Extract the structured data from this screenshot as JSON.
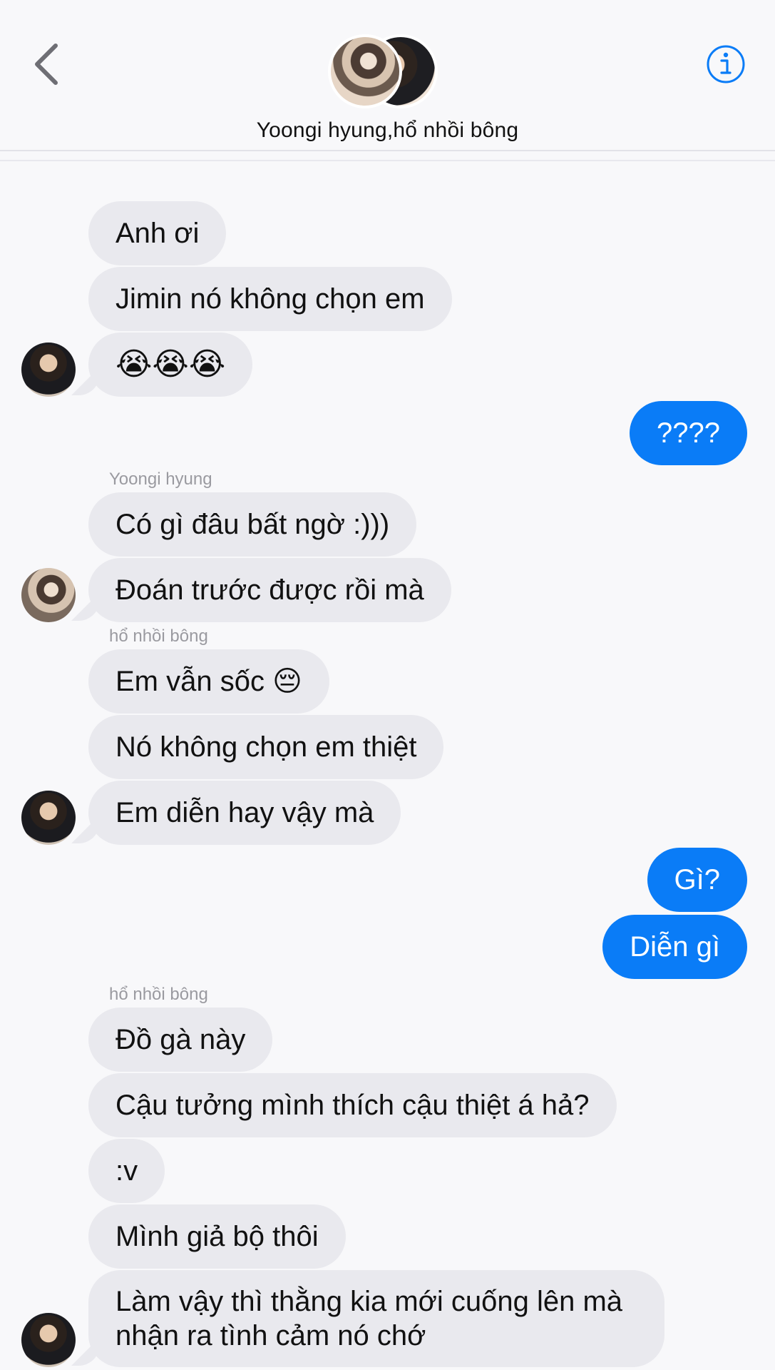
{
  "header": {
    "title": "Yoongi hyung,hổ nhồi bông",
    "back_icon": "chevron-left-icon",
    "info_icon": "info-icon",
    "accent": "#0a7cf7"
  },
  "messages": {
    "m1": "Anh ơi",
    "m2": "Jimin nó không chọn em",
    "m3": "😭😭😭",
    "m4": "????",
    "sender_yoongi": "Yoongi hyung",
    "m5": "Có gì đâu bất ngờ :)))",
    "m6": "Đoán trước được rồi mà",
    "sender_ho1": "hổ nhồi bông",
    "m7": "Em vẫn sốc 😔",
    "m8": "Nó không chọn em thiệt",
    "m9": "Em diễn hay vậy mà",
    "m10": "Gì?",
    "m11": "Diễn gì",
    "sender_ho2": "hổ nhồi bông",
    "m12": "Đồ gà này",
    "m13": "Cậu tưởng mình thích cậu thiệt á hả?",
    "m14": ":v",
    "m15": "Mình giả bộ thôi",
    "m16": "Làm vậy thì thằng kia mới cuống lên mà nhận ra tình cảm nó chớ"
  },
  "colors": {
    "incoming_bubble": "#e9e9ee",
    "outgoing_bubble": "#0a7cf7",
    "background": "#f8f8fa"
  }
}
